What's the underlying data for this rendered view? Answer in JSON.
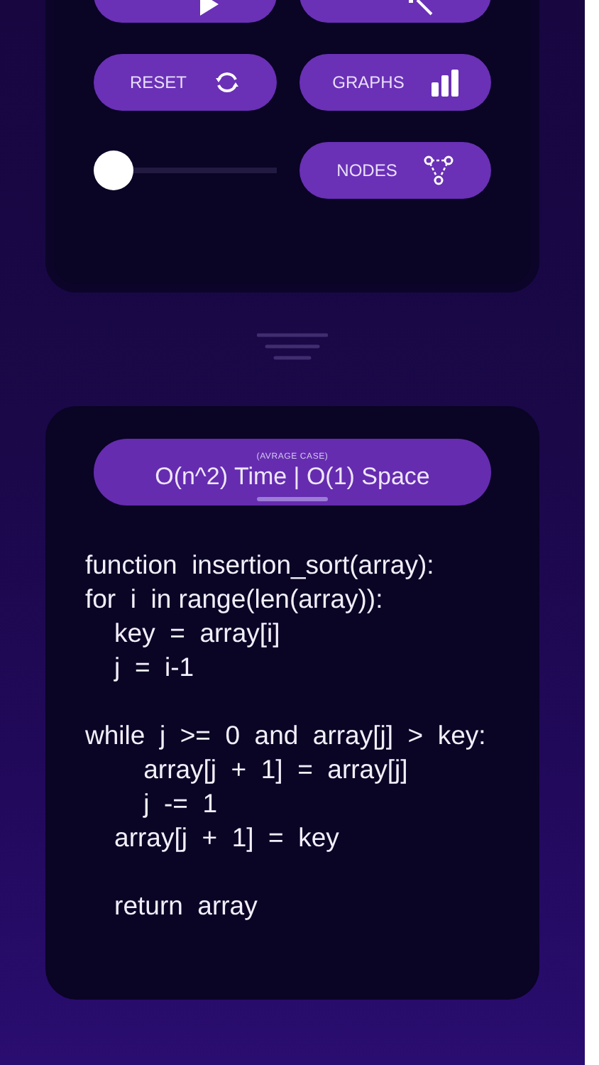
{
  "controls": [
    {
      "kind": "button"
    },
    {
      "kind": "button"
    },
    {
      "kind": "button",
      "label": "RESET"
    },
    {
      "kind": "button",
      "label": "GRAPHS"
    },
    {
      "kind": "slider",
      "level": 0.0
    },
    {
      "kind": "button",
      "label": "NODES"
    }
  ],
  "complexity": {
    "caption": "(AVRAGE CASE)",
    "value": "O(n^2) Time | O(1) Space"
  },
  "code": [
    [
      "function  insertion_sort(array):",
      "for  i  in range(len(array)):",
      "    key  =  array[i]",
      "    j  =  i-1"
    ],
    [
      "while  j  >=  0  and  array[j]  >  key:",
      "        array[j  +  1]  =  array[j]",
      "        j  -=  1",
      "    array[j  +  1]  =  key"
    ],
    [
      "    return  array"
    ]
  ]
}
